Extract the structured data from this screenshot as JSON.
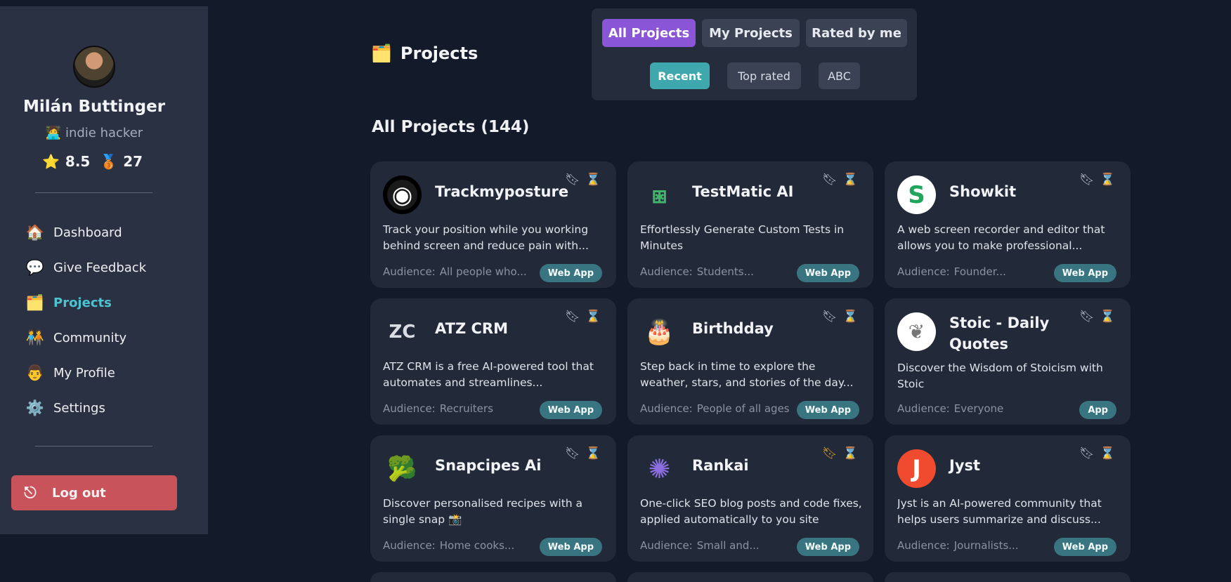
{
  "user": {
    "name": "Milán Buttinger",
    "role_icon": "🧑‍💻",
    "role": "indie hacker",
    "rating_icon": "⭐",
    "rating": "8.5",
    "medal_icon": "🥉",
    "medals": "27"
  },
  "nav": [
    {
      "icon": "🏠",
      "label": "Dashboard"
    },
    {
      "icon": "💬",
      "label": "Give Feedback"
    },
    {
      "icon": "🗂️",
      "label": "Projects"
    },
    {
      "icon": "🧑‍🤝‍🧑",
      "label": "Community"
    },
    {
      "icon": "👨",
      "label": "My Profile"
    },
    {
      "icon": "⚙️",
      "label": "Settings"
    }
  ],
  "logout": {
    "icon": "⎋",
    "label": "Log out"
  },
  "header": {
    "icon": "🗂️",
    "title": "Projects"
  },
  "filters": {
    "tabs": [
      "All Projects",
      "My Projects",
      "Rated by me"
    ],
    "sort": [
      "Recent",
      "Top rated",
      "ABC"
    ]
  },
  "section_title": "All Projects (144)",
  "audience_label": "Audience:",
  "cards": [
    {
      "title": "Trackmyposture",
      "description": "Track your position while you working behind screen and reduce pain with...",
      "audience": "All people who...",
      "badge": "Web App",
      "logo_icon": "eye-ring-logo"
    },
    {
      "title": "TestMatic AI",
      "description": "Effortlessly Generate Custom Tests in Minutes",
      "audience": "Students...",
      "badge": "Web App",
      "logo_icon": "lattice-logo"
    },
    {
      "title": "Showkit",
      "description": "A web screen recorder and editor that allows you to make professional...",
      "audience": "Founder...",
      "badge": "Web App",
      "logo_icon": "s-logo"
    },
    {
      "title": "ATZ CRM",
      "description": "ATZ CRM is a free AI-powered tool that automates and streamlines...",
      "audience": "Recruiters",
      "badge": "Web App",
      "logo_icon": "atz-logo"
    },
    {
      "title": "Birthdday",
      "description": "Step back in time to explore the weather, stars, and stories of the day...",
      "audience": "People of all ages",
      "badge": "Web App",
      "logo_icon": "cake-logo"
    },
    {
      "title": "Stoic - Daily Quotes",
      "description": "Discover the Wisdom of Stoicism with Stoic",
      "audience": "Everyone",
      "badge": "App",
      "logo_icon": "laurel-logo"
    },
    {
      "title": "Snapcipes Ai",
      "description": "Discover personalised recipes with a single snap 📸",
      "audience": "Home cooks...",
      "badge": "Web App",
      "logo_icon": "broccoli-logo"
    },
    {
      "title": "Rankai",
      "description": "One-click SEO blog posts and code fixes, applied automatically to you site",
      "audience": "Small and...",
      "badge": "Web App",
      "logo_icon": "star-burst-logo"
    },
    {
      "title": "Jyst",
      "description": "Jyst is an AI-powered community that helps users summarize and discuss...",
      "audience": "Journalists...",
      "badge": "Web App",
      "logo_icon": "j-logo"
    }
  ]
}
